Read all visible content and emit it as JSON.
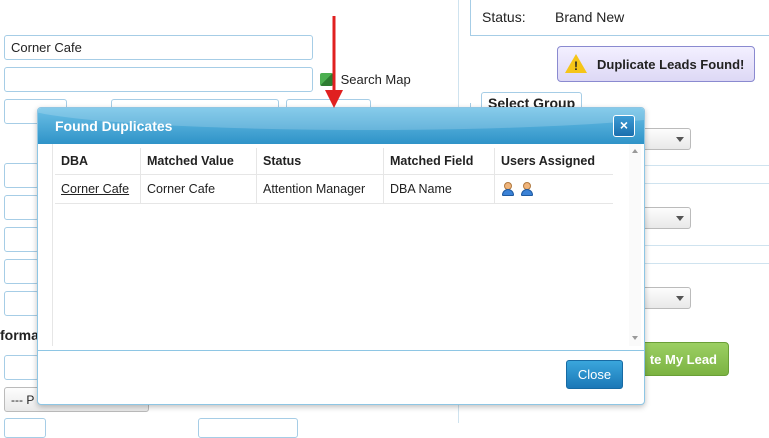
{
  "form": {
    "dba_value": "Corner Cafe",
    "search_map_label": "Search Map",
    "section_label_partial": "forma",
    "select_partial": "--- P"
  },
  "right": {
    "status_label": "Status:",
    "status_value": "Brand New",
    "duplicate_button": "Duplicate Leads Found!",
    "select_group_label": "Select Group",
    "create_lead_partial": "te My Lead"
  },
  "modal": {
    "title": "Found Duplicates",
    "close_x": "×",
    "close_button": "Close",
    "columns": [
      "DBA",
      "Matched Value",
      "Status",
      "Matched Field",
      "Users Assigned"
    ],
    "rows": [
      {
        "dba": "Corner Cafe",
        "matched_value": "Corner Cafe",
        "status": "Attention Manager",
        "matched_field": "DBA Name",
        "users": [
          "user-icon",
          "user-icon"
        ]
      }
    ]
  },
  "colors": {
    "accent": "#2f93c8",
    "green_button": "#8cc152",
    "annotation_arrow": "#e02020"
  }
}
